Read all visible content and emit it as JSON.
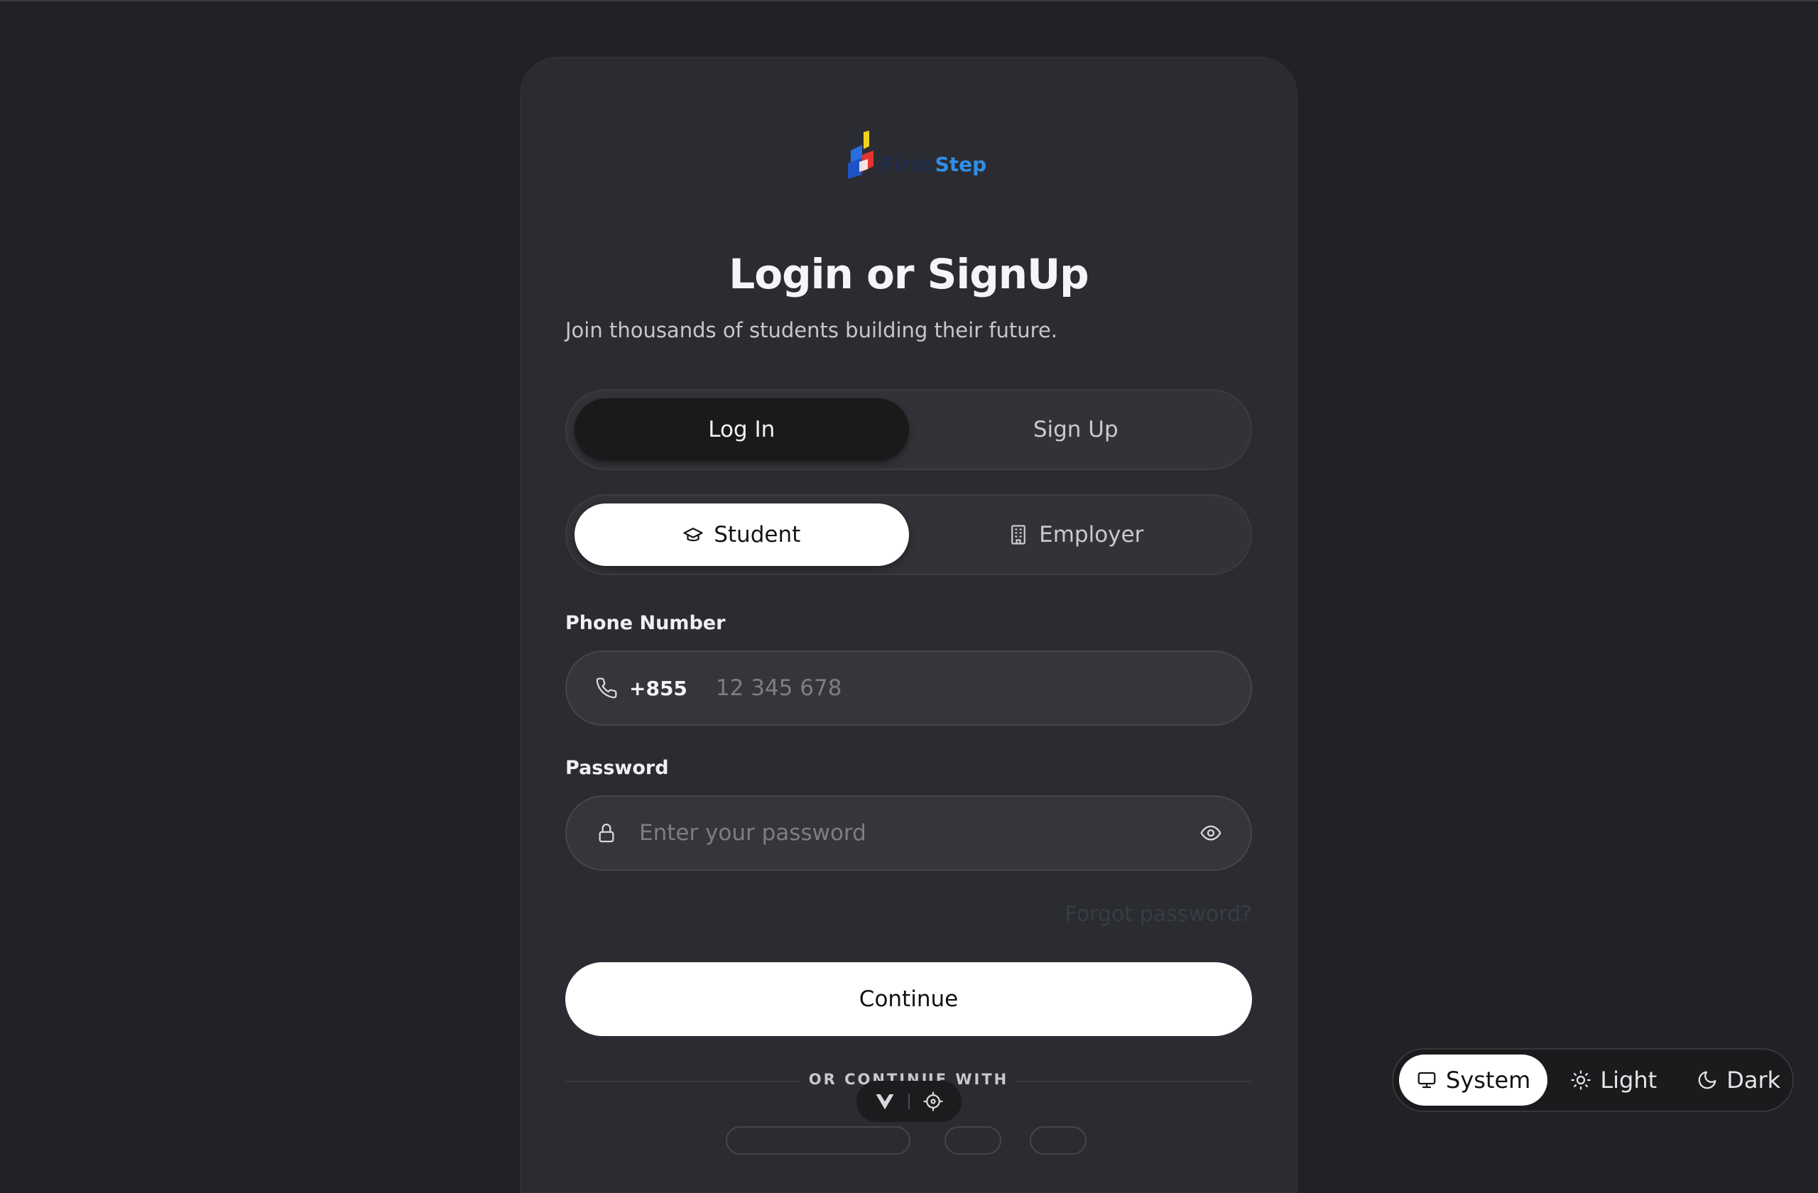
{
  "brand": {
    "name_first": "First",
    "name_second": "Step"
  },
  "header": {
    "title": "Login or SignUp",
    "subtitle": "Join thousands of students building their future."
  },
  "auth_mode": {
    "login_label": "Log In",
    "signup_label": "Sign Up",
    "selected": "Log In"
  },
  "role": {
    "student_label": "Student",
    "employer_label": "Employer",
    "selected": "Student"
  },
  "phone": {
    "label": "Phone Number",
    "dial_code": "+855",
    "placeholder": "12 345 678",
    "value": ""
  },
  "password": {
    "label": "Password",
    "placeholder": "Enter your password",
    "value": ""
  },
  "forgot_label": "Forgot password?",
  "continue_label": "Continue",
  "divider_label": "OR CONTINUE WITH",
  "theme_switcher": {
    "system_label": "System",
    "light_label": "Light",
    "dark_label": "Dark",
    "selected": "System"
  },
  "colors": {
    "page_bg": "#212226",
    "card_bg": "#2b2c31",
    "brand_blue": "#2f8fe6",
    "primary_button": "#ffffff"
  }
}
